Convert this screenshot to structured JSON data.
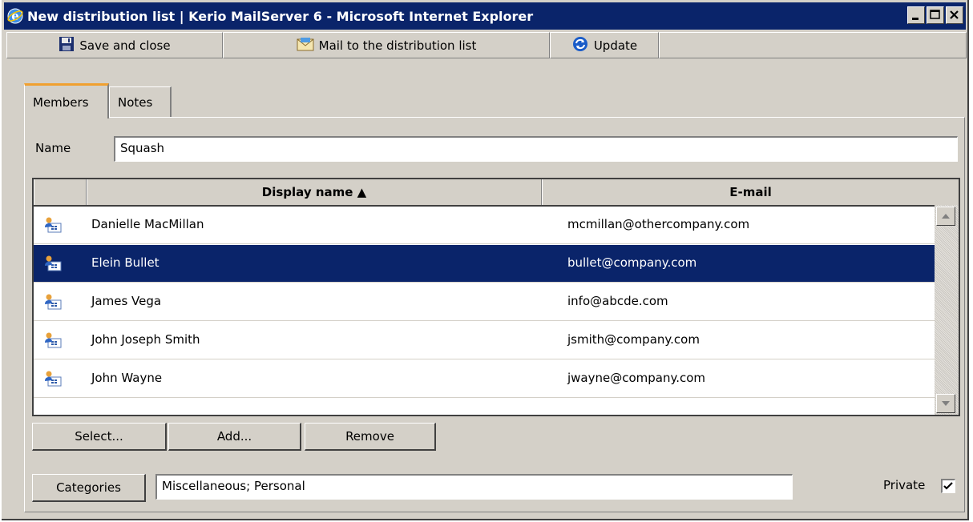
{
  "window": {
    "title": "New distribution list | Kerio MailServer 6 - Microsoft Internet Explorer",
    "title_bar_color": "#0a246a"
  },
  "toolbar": {
    "save_close_label": "Save and close",
    "mail_to_label": "Mail to the distribution list",
    "update_label": "Update"
  },
  "tabs": [
    {
      "label": "Members",
      "active": true
    },
    {
      "label": "Notes",
      "active": false
    }
  ],
  "form": {
    "name_label": "Name",
    "name_value": "Squash"
  },
  "grid": {
    "columns": [
      "Display name ▲",
      "E-mail"
    ],
    "rows": [
      {
        "name": "Danielle MacMillan",
        "email": "mcmillan@othercompany.com",
        "selected": false
      },
      {
        "name": "Elein Bullet",
        "email": "bullet@company.com",
        "selected": true
      },
      {
        "name": "James Vega",
        "email": "info@abcde.com",
        "selected": false
      },
      {
        "name": "John Joseph Smith",
        "email": "jsmith@company.com",
        "selected": false
      },
      {
        "name": "John Wayne",
        "email": "jwayne@company.com",
        "selected": false
      }
    ],
    "row_icon": "contact-card-icon",
    "selection_color": "#0a246a"
  },
  "actions": {
    "select_label": "Select...",
    "add_label": "Add...",
    "remove_label": "Remove"
  },
  "footer": {
    "categories_label": "Categories",
    "categories_value": "Miscellaneous; Personal",
    "private_label": "Private",
    "private_checked": true
  }
}
